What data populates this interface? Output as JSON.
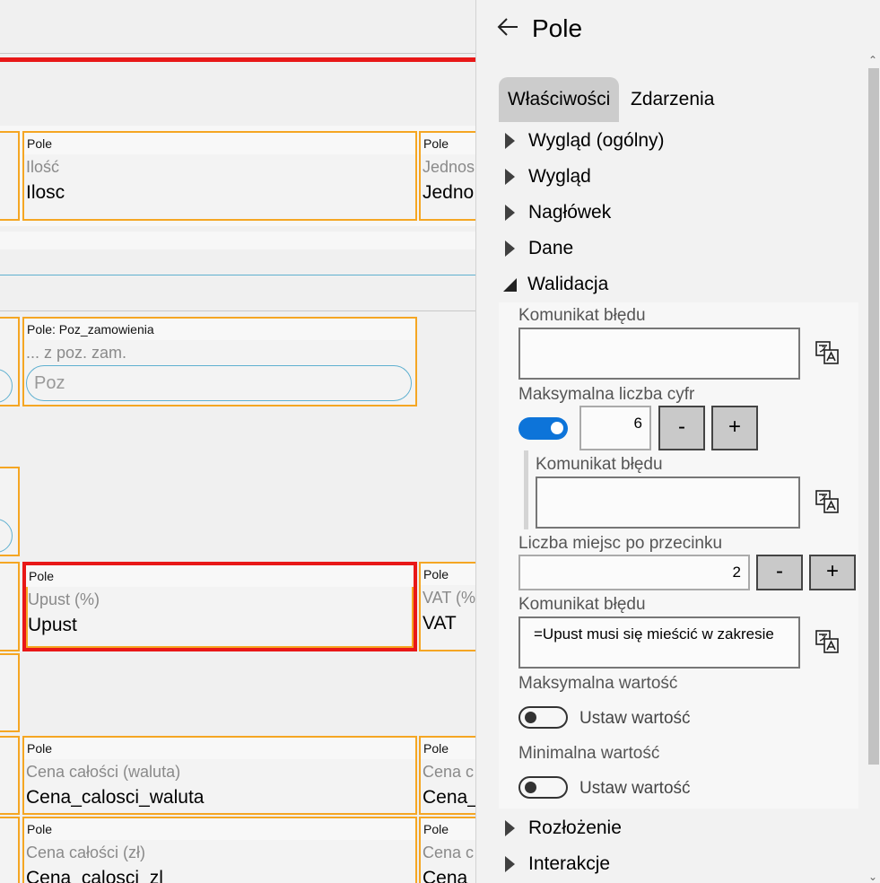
{
  "canvas": {
    "fields": {
      "ilosc": {
        "caption": "Pole",
        "label": "Ilość",
        "value": "Ilosc"
      },
      "jednostka": {
        "caption": "Pole",
        "label": "Jednos",
        "value": "Jedno"
      },
      "poz_zamowienia": {
        "caption": "Pole: Poz_zamowienia",
        "label": "... z poz. zam.",
        "placeholder": "Poz"
      },
      "upust": {
        "caption": "Pole",
        "label": "Upust (%)",
        "value": "Upust"
      },
      "vat": {
        "caption": "Pole",
        "label": "VAT (%",
        "value": "VAT"
      },
      "cena_calosci_waluta": {
        "caption": "Pole",
        "label": "Cena całości (waluta)",
        "value": "Cena_calosci_waluta"
      },
      "cena_calosci_waluta_right": {
        "caption": "Pole",
        "label": "Cena c",
        "value": "Cena_"
      },
      "cena_calosci_zl": {
        "caption": "Pole",
        "label": "Cena całości (zł)",
        "value": "Cena_calosci_zl"
      },
      "cena_calosci_zl_right": {
        "caption": "Pole",
        "label": "Cena c",
        "value": "Cena_"
      }
    }
  },
  "panel": {
    "title": "Pole",
    "tabs": {
      "properties": "Właściwości",
      "events": "Zdarzenia"
    },
    "groups": {
      "appearance_general": "Wygląd (ogólny)",
      "appearance": "Wygląd",
      "header": "Nagłówek",
      "data": "Dane",
      "validation": "Walidacja",
      "layout": "Rozłożenie",
      "interactions": "Interakcje"
    },
    "validation": {
      "error_message_label": "Komunikat błędu",
      "error_message_value": "",
      "max_digits_label": "Maksymalna liczba cyfr",
      "max_digits_enabled": true,
      "max_digits_value": "6",
      "max_digits_error_label": "Komunikat błędu",
      "max_digits_error_value": "",
      "decimal_places_label": "Liczba miejsc po przecinku",
      "decimal_places_value": "2",
      "decimal_error_label": "Komunikat błędu",
      "decimal_error_value": "=Upust musi się mieścić w zakresie",
      "max_value_label": "Maksymalna wartość",
      "max_value_enabled": false,
      "max_value_toggle_text": "Ustaw wartość",
      "min_value_label": "Minimalna wartość",
      "min_value_enabled": false,
      "min_value_toggle_text": "Ustaw wartość",
      "minus": "-",
      "plus": "+"
    }
  },
  "colors": {
    "field_border": "#f5a623",
    "selection_border": "#e81818",
    "toggle_on": "#0d74d9",
    "active_tab": "#cccccc"
  },
  "icons": [
    "back-arrow-icon",
    "translate-icon",
    "expand-arrow-icon",
    "collapse-arrow-icon"
  ]
}
